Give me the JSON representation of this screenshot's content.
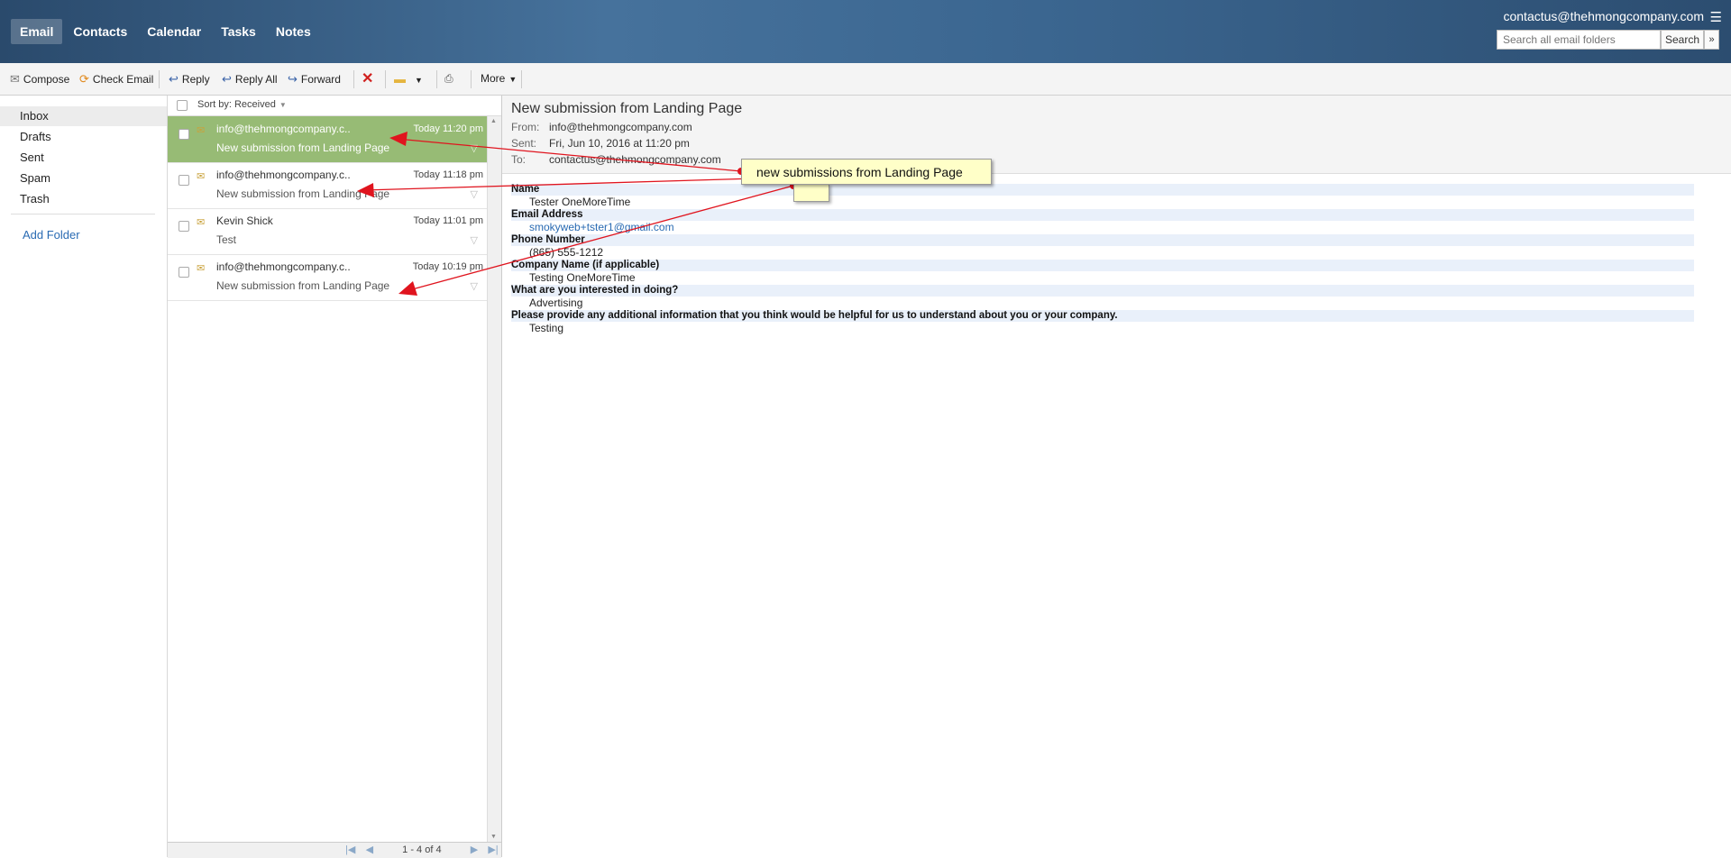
{
  "header": {
    "nav": [
      "Email",
      "Contacts",
      "Calendar",
      "Tasks",
      "Notes"
    ],
    "account": "contactus@thehmongcompany.com",
    "search_placeholder": "Search all email folders",
    "search_button": "Search",
    "menu_icon": "hamburger-icon",
    "search_options_icon": "double-chevron-down-icon"
  },
  "toolbar": {
    "compose": "Compose",
    "check_email": "Check Email",
    "reply": "Reply",
    "reply_all": "Reply All",
    "forward": "Forward",
    "more": "More",
    "delete_icon": "red-x-delete-icon",
    "move_icon": "folder-move-icon",
    "print_icon": "printer-icon"
  },
  "sidebar": {
    "folders": [
      "Inbox",
      "Drafts",
      "Sent",
      "Spam",
      "Trash"
    ],
    "add_folder": "Add Folder"
  },
  "message_list": {
    "sort_label": "Sort by: Received",
    "messages": [
      {
        "from": "info@thehmongcompany.c..",
        "time": "Today 11:20 pm",
        "subject": "New submission from Landing Page",
        "selected": true
      },
      {
        "from": "info@thehmongcompany.c..",
        "time": "Today 11:18 pm",
        "subject": "New submission from Landing Page",
        "selected": false
      },
      {
        "from": "Kevin Shick",
        "time": "Today 11:01 pm",
        "subject": "Test",
        "selected": false
      },
      {
        "from": "info@thehmongcompany.c..",
        "time": "Today 10:19 pm",
        "subject": "New submission from Landing Page",
        "selected": false
      }
    ],
    "pager": "1 - 4 of 4"
  },
  "email": {
    "subject": "New submission from Landing Page",
    "from_label": "From:",
    "from": "info@thehmongcompany.com",
    "sent_label": "Sent:",
    "sent": "Fri, Jun 10, 2016 at 11:20 pm",
    "to_label": "To:",
    "to": "contactus@thehmongcompany.com",
    "fields": [
      {
        "label": "Name",
        "value": "Tester OneMoreTime"
      },
      {
        "label": "Email Address",
        "value": "smokyweb+tster1@gmail.com"
      },
      {
        "label": "Phone Number",
        "value": "(865) 555-1212"
      },
      {
        "label": "Company Name (if applicable)",
        "value": "Testing OneMoreTime"
      },
      {
        "label": "What are you interested in doing?",
        "value": "Advertising"
      },
      {
        "label": "Please provide any additional information that you think would be helpful for us to understand about you or your company.",
        "value": "Testing"
      }
    ]
  },
  "annotation": {
    "text": "new submissions from Landing Page",
    "arrow_color": "#e0141e"
  },
  "colors": {
    "header_blue": "#46729c",
    "selected_row": "#97bb75",
    "link": "#2a6bb3",
    "callout_bg": "#ffffc8"
  }
}
